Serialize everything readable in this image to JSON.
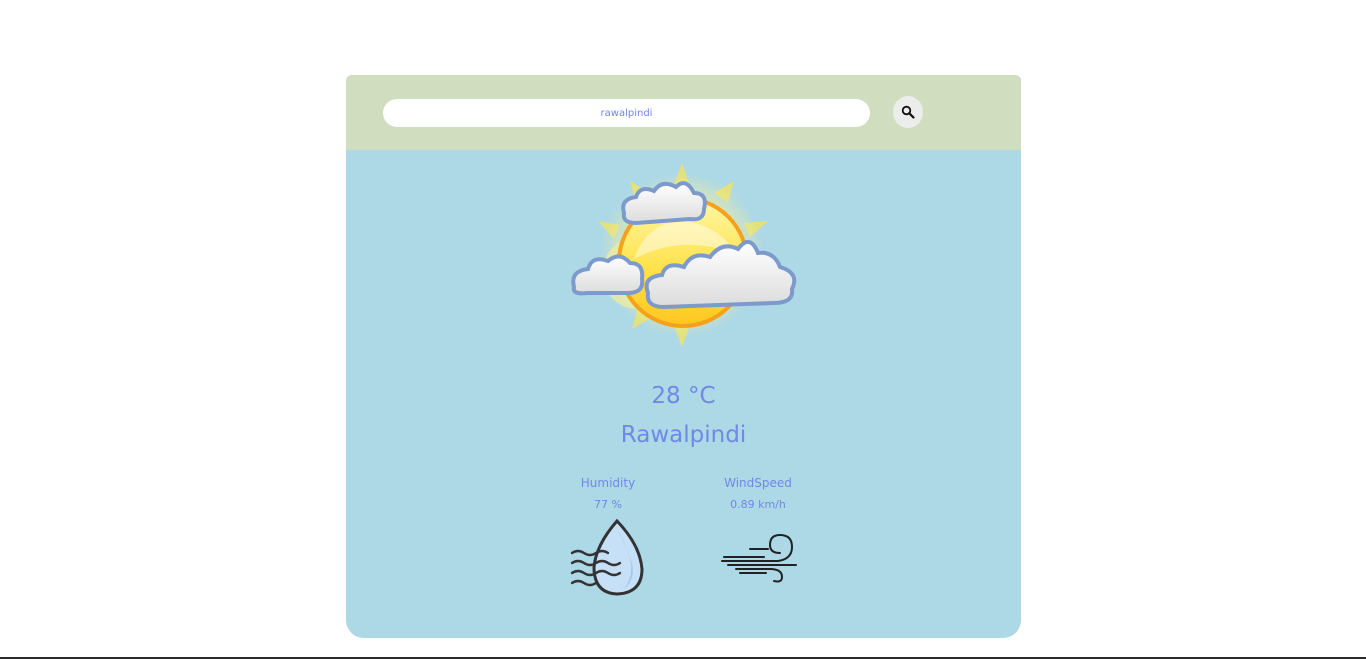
{
  "search": {
    "value": "rawalpindi",
    "button_icon": "search-icon"
  },
  "weather": {
    "icon": "partly-cloudy-icon",
    "temperature": "28 °C",
    "city": "Rawalpindi"
  },
  "stats": {
    "humidity": {
      "label": "Humidity",
      "value": "77 %",
      "icon": "humidity-icon"
    },
    "wind": {
      "label": "WindSpeed",
      "value": "0.89 km/h",
      "icon": "wind-icon"
    }
  },
  "colors": {
    "card_background": "#add8e6",
    "header_background": "#d0ddbf",
    "text_accent": "#7088e6"
  }
}
